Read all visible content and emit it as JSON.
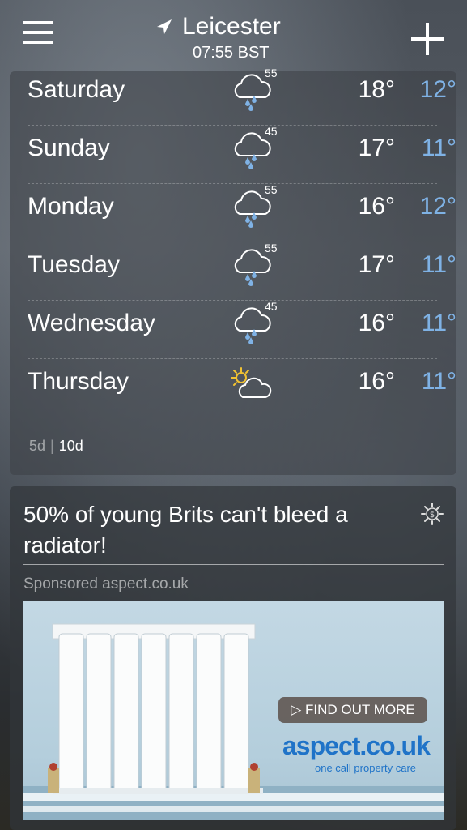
{
  "header": {
    "location": "Leicester",
    "time": "07:55 BST"
  },
  "forecast": {
    "days": [
      {
        "day": "Saturday",
        "icon": "rain-cloud-icon",
        "precip": "55",
        "high": "18°",
        "low": "12°"
      },
      {
        "day": "Sunday",
        "icon": "rain-cloud-icon",
        "precip": "45",
        "high": "17°",
        "low": "11°"
      },
      {
        "day": "Monday",
        "icon": "rain-cloud-icon",
        "precip": "55",
        "high": "16°",
        "low": "12°"
      },
      {
        "day": "Tuesday",
        "icon": "rain-cloud-icon",
        "precip": "55",
        "high": "17°",
        "low": "11°"
      },
      {
        "day": "Wednesday",
        "icon": "rain-cloud-icon",
        "precip": "45",
        "high": "16°",
        "low": "11°"
      },
      {
        "day": "Thursday",
        "icon": "partly-sunny-icon",
        "precip": "",
        "high": "16°",
        "low": "11°"
      }
    ],
    "toggle": {
      "five_day": "5d",
      "ten_day": "10d"
    }
  },
  "ad": {
    "title": "50% of young Brits can't bleed a radiator!",
    "sponsored": "Sponsored aspect.co.uk",
    "cta": "FIND OUT MORE",
    "brand": "aspect.co.uk",
    "tagline": "one call property care"
  },
  "colors": {
    "low_temp": "#7fb2e5",
    "brand_blue": "#1f73c8"
  }
}
